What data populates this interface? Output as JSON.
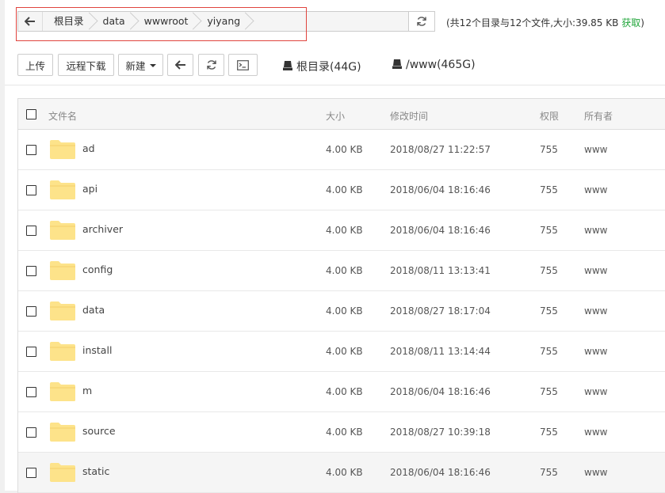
{
  "address_bar": {
    "breadcrumbs": [
      "根目录",
      "data",
      "wwwroot",
      "yiyang"
    ]
  },
  "summary": {
    "text": "(共12个目录与12个文件,大小:39.85 KB",
    "fetch_label": "获取",
    "close": ")"
  },
  "toolbar": {
    "upload_label": "上传",
    "remote_download_label": "远程下载",
    "new_label": "新建",
    "disks": [
      "根目录(44G)",
      "/www(465G)"
    ]
  },
  "table": {
    "headers": {
      "name": "文件名",
      "size": "大小",
      "mtime": "修改时间",
      "perm": "权限",
      "owner": "所有者"
    },
    "rows": [
      {
        "name": "ad",
        "size": "4.00 KB",
        "mtime": "2018/08/27 11:22:57",
        "perm": "755",
        "owner": "www"
      },
      {
        "name": "api",
        "size": "4.00 KB",
        "mtime": "2018/06/04 18:16:46",
        "perm": "755",
        "owner": "www"
      },
      {
        "name": "archiver",
        "size": "4.00 KB",
        "mtime": "2018/06/04 18:16:46",
        "perm": "755",
        "owner": "www"
      },
      {
        "name": "config",
        "size": "4.00 KB",
        "mtime": "2018/08/11 13:13:41",
        "perm": "755",
        "owner": "www"
      },
      {
        "name": "data",
        "size": "4.00 KB",
        "mtime": "2018/08/27 18:17:04",
        "perm": "755",
        "owner": "www"
      },
      {
        "name": "install",
        "size": "4.00 KB",
        "mtime": "2018/08/11 13:14:44",
        "perm": "755",
        "owner": "www"
      },
      {
        "name": "m",
        "size": "4.00 KB",
        "mtime": "2018/06/04 18:16:46",
        "perm": "755",
        "owner": "www"
      },
      {
        "name": "source",
        "size": "4.00 KB",
        "mtime": "2018/08/27 10:39:18",
        "perm": "755",
        "owner": "www"
      },
      {
        "name": "static",
        "size": "4.00 KB",
        "mtime": "2018/06/04 18:16:46",
        "perm": "755",
        "owner": "www"
      }
    ]
  },
  "colors": {
    "accent_green": "#20a53a",
    "highlight_red": "#e0443e",
    "folder_yellow": "#fde38a"
  },
  "icons": {
    "back": "arrow-left-icon",
    "refresh": "refresh-icon",
    "terminal": "terminal-icon",
    "disk": "hard-disk-icon",
    "folder": "folder-icon"
  }
}
